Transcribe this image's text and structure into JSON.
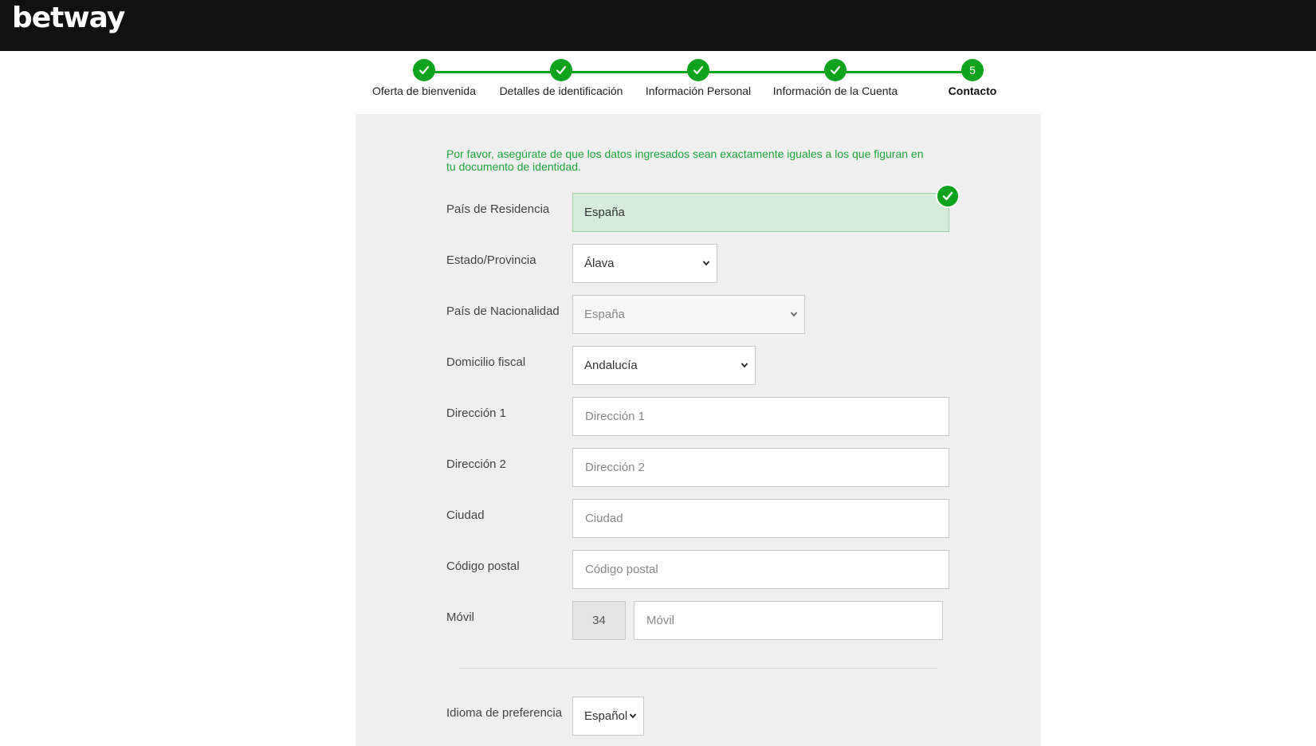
{
  "brand": {
    "logo_text": "betway",
    "accent_color": "#0fa31d",
    "header_color": "#111111"
  },
  "steps": [
    {
      "label": "Oferta de bienvenida",
      "state": "done",
      "icon": "check-icon"
    },
    {
      "label": "Detalles de identificación",
      "state": "done",
      "icon": "check-icon"
    },
    {
      "label": "Información Personal",
      "state": "done",
      "icon": "check-icon"
    },
    {
      "label": "Información de la Cuenta",
      "state": "done",
      "icon": "check-icon"
    },
    {
      "label": "Contacto",
      "state": "active",
      "number": "5"
    }
  ],
  "form": {
    "notice": "Por favor, asegúrate de que los datos ingresados sean exactamente iguales a los que figuran en tu documento de identidad.",
    "residence": {
      "label": "País de Residencia",
      "value": "España",
      "status_icon": "check-circle-icon"
    },
    "state": {
      "label": "Estado/Provincia",
      "value": "Álava"
    },
    "nationality": {
      "label": "País de Nacionalidad",
      "value": "España"
    },
    "tax_domicile": {
      "label": "Domicilio fiscal",
      "value": "Andalucía"
    },
    "address1": {
      "label": "Dirección 1",
      "placeholder": "Dirección 1"
    },
    "address2": {
      "label": "Dirección 2",
      "placeholder": "Dirección 2"
    },
    "city": {
      "label": "Ciudad",
      "placeholder": "Ciudad"
    },
    "postal": {
      "label": "Código postal",
      "placeholder": "Código postal"
    },
    "mobile": {
      "label": "Móvil",
      "prefix": "34",
      "placeholder": "Móvil"
    },
    "language": {
      "label": "Idioma de preferencia",
      "value": "Español"
    }
  }
}
